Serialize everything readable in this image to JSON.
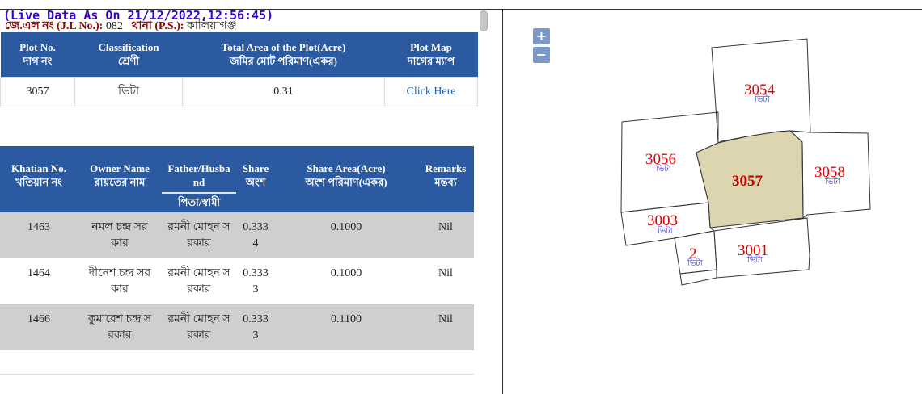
{
  "header": {
    "live_text": "(Live Data As On 21/12/2022,12:56:45)",
    "jl_label": "জে.এল নং (J.L No.):",
    "jl_value": "082",
    "ps_label": "থানা (P.S.):",
    "ps_value": "কালিয়াগঞ্জ"
  },
  "plot_table": {
    "headers": [
      {
        "en": "Plot No.",
        "bn": "দাগ নং"
      },
      {
        "en": "Classification",
        "bn": "শ্রেণী"
      },
      {
        "en": "Total Area of the Plot(Acre)",
        "bn": "জমির মোট পরিমাণ(একর)"
      },
      {
        "en": "Plot Map",
        "bn": "দাগের ম্যাপ"
      }
    ],
    "row": {
      "plot_no": "3057",
      "classification": "ভিটা",
      "area": "0.31",
      "map_link": "Click Here"
    }
  },
  "owner_table": {
    "headers": [
      {
        "en": "Khatian No.",
        "bn": "খতিয়ান নং"
      },
      {
        "en": "Owner Name",
        "bn": "রায়তের নাম"
      },
      {
        "en": "Father/Husba nd",
        "bn": "পিতা/স্বামী"
      },
      {
        "en": "Share",
        "bn": "অংশ"
      },
      {
        "en": "Share Area(Acre)",
        "bn": "অংশ পরিমাণ(একর)"
      },
      {
        "en": "Remarks",
        "bn": "মন্তব্য"
      }
    ],
    "rows": [
      {
        "khatian": "1463",
        "owner_l1": "নমল চন্দ্র সর",
        "owner_l2": "কার",
        "father_l1": "রমনী মোহন স",
        "father_l2": "রকার",
        "share_l1": "0.333",
        "share_l2": "4",
        "share_area": "0.1000",
        "remarks": "Nil"
      },
      {
        "khatian": "1464",
        "owner_l1": "দীনেশ চন্দ্র সর",
        "owner_l2": "কার",
        "father_l1": "রমনী মোহন স",
        "father_l2": "রকার",
        "share_l1": "0.333",
        "share_l2": "3",
        "share_area": "0.1000",
        "remarks": "Nil"
      },
      {
        "khatian": "1466",
        "owner_l1": "কুমারেশ চন্দ্র স",
        "owner_l2": "রকার",
        "father_l1": "রমনী মোহন স",
        "father_l2": "রকার",
        "share_l1": "0.333",
        "share_l2": "3",
        "share_area": "0.1100",
        "remarks": "Nil"
      }
    ]
  },
  "map": {
    "zoom_in": "+",
    "zoom_out": "−",
    "plots": [
      {
        "no": "3054",
        "cls": "ভিটা"
      },
      {
        "no": "3056",
        "cls": "ভিটা"
      },
      {
        "no": "3057",
        "cls": ""
      },
      {
        "no": "3058",
        "cls": "ভিটা"
      },
      {
        "no": "3003",
        "cls": "ভিটা"
      },
      {
        "no": "2",
        "cls": "ভিটা"
      },
      {
        "no": "3001",
        "cls": "ভিটা"
      }
    ],
    "highlight_color": "#ddd4b0"
  }
}
